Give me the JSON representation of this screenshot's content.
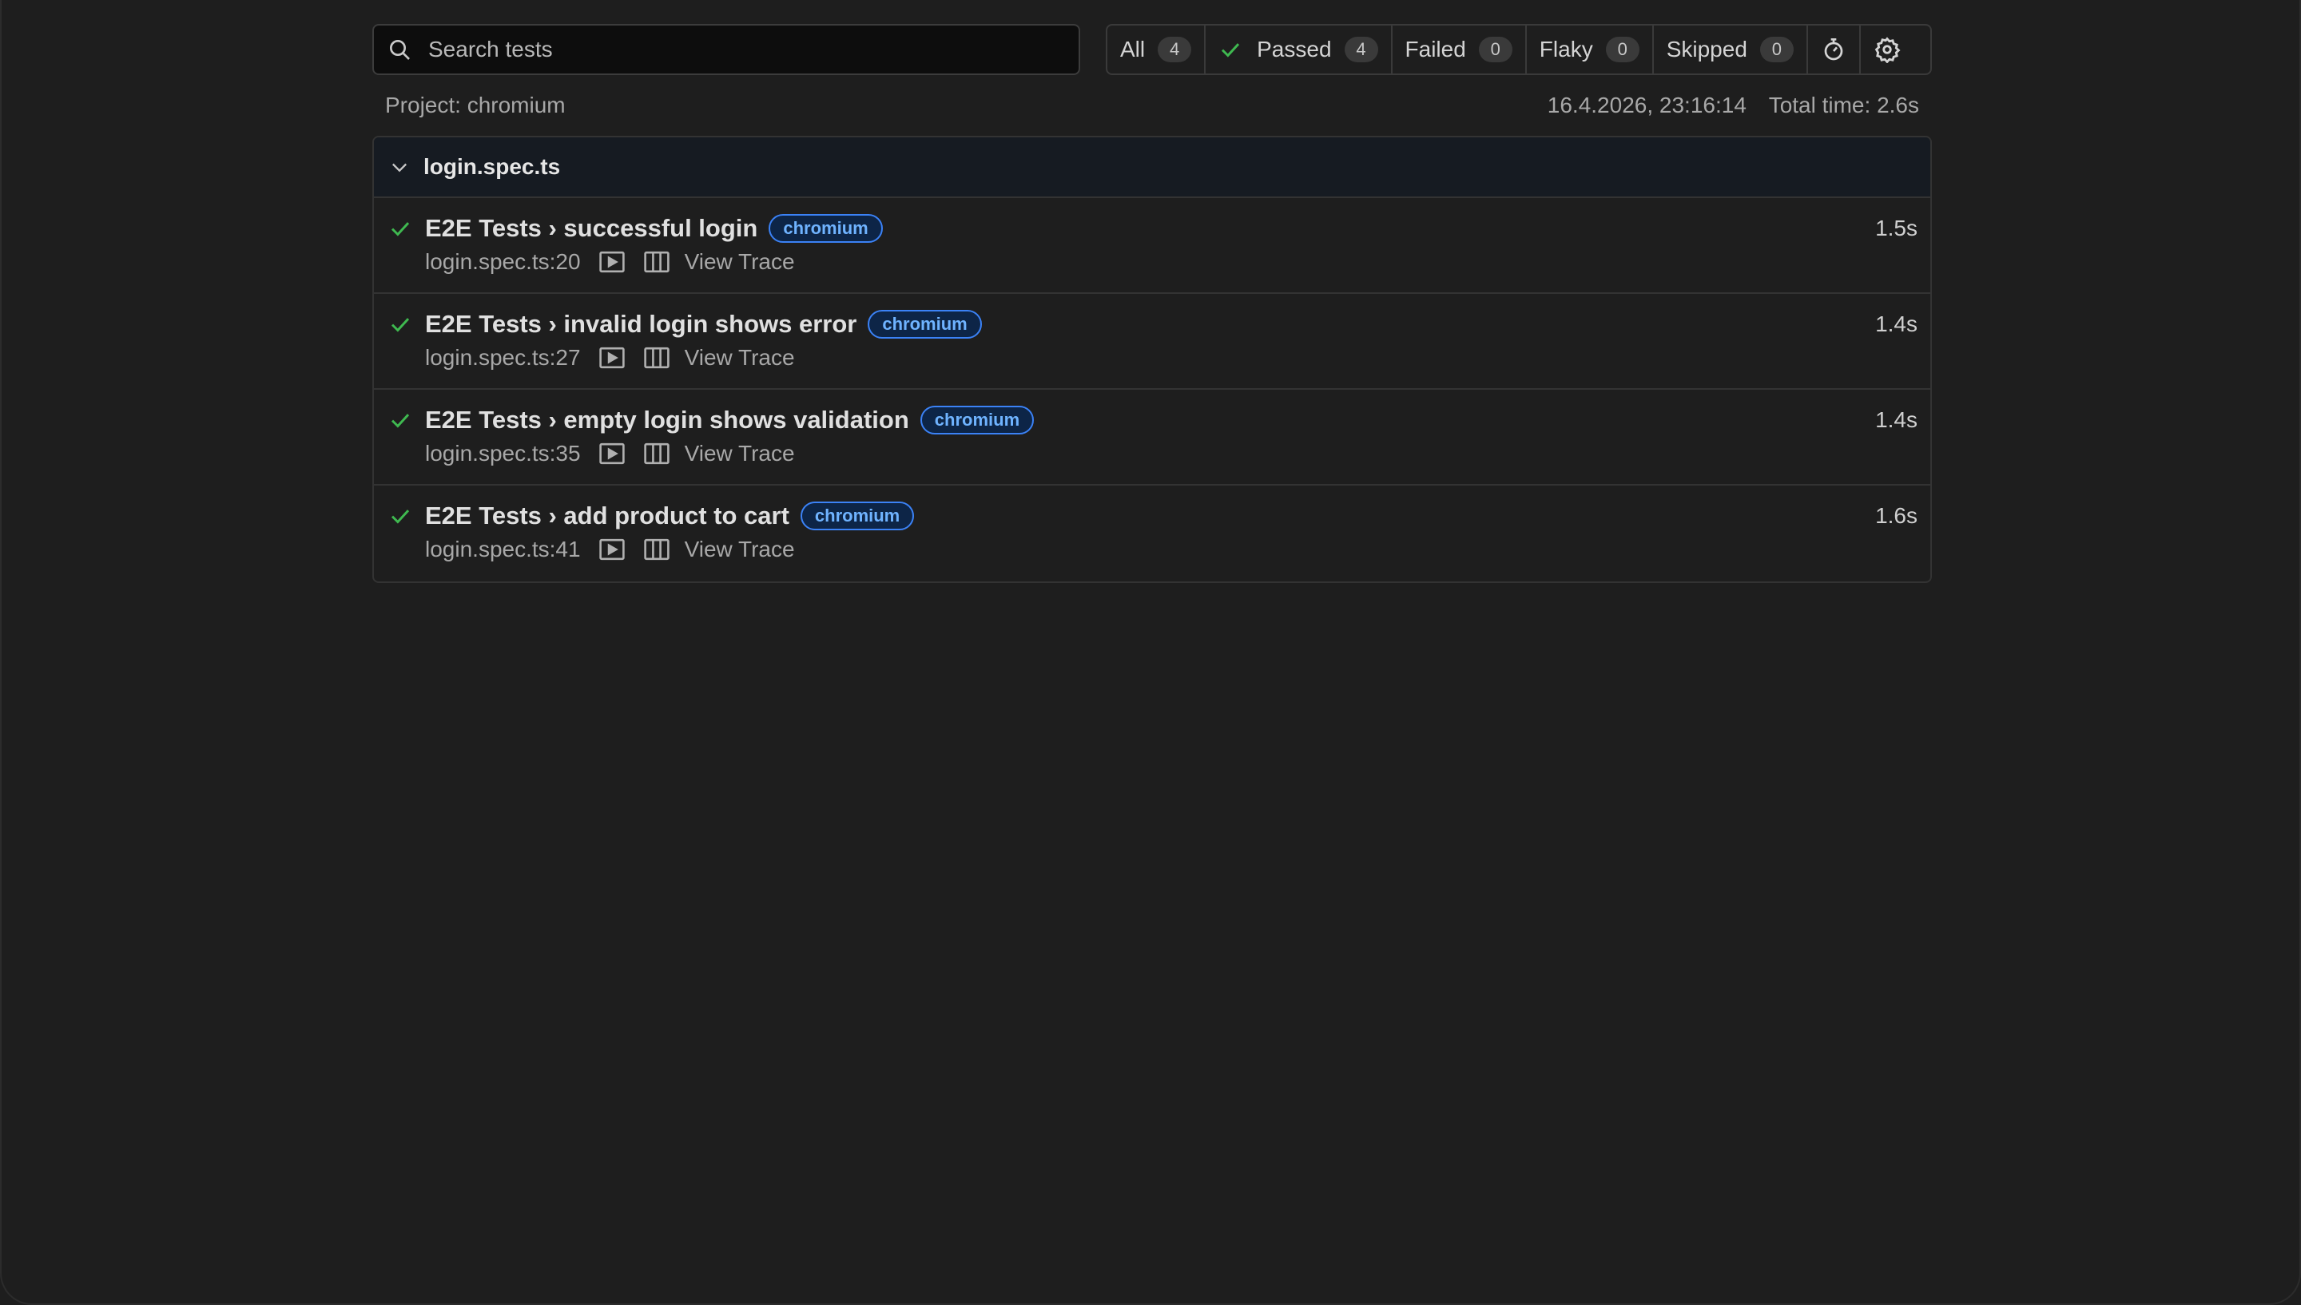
{
  "search": {
    "placeholder": "Search tests"
  },
  "filters": {
    "all": {
      "label": "All",
      "count": "4"
    },
    "passed": {
      "label": "Passed",
      "count": "4"
    },
    "failed": {
      "label": "Failed",
      "count": "0"
    },
    "flaky": {
      "label": "Flaky",
      "count": "0"
    },
    "skipped": {
      "label": "Skipped",
      "count": "0"
    }
  },
  "meta": {
    "project": "Project: chromium",
    "datetime": "16.4.2026, 23:16:14",
    "total_time": "Total time: 2.6s"
  },
  "file": {
    "name": "login.spec.ts"
  },
  "tests": [
    {
      "title": "E2E Tests › successful login",
      "tag": "chromium",
      "location": "login.spec.ts:20",
      "trace": "View Trace",
      "duration": "1.5s"
    },
    {
      "title": "E2E Tests › invalid login shows error",
      "tag": "chromium",
      "location": "login.spec.ts:27",
      "trace": "View Trace",
      "duration": "1.4s"
    },
    {
      "title": "E2E Tests › empty login shows validation",
      "tag": "chromium",
      "location": "login.spec.ts:35",
      "trace": "View Trace",
      "duration": "1.4s"
    },
    {
      "title": "E2E Tests › add product to cart",
      "tag": "chromium",
      "location": "login.spec.ts:41",
      "trace": "View Trace",
      "duration": "1.6s"
    }
  ],
  "colors": {
    "pass": "#3fb950",
    "tag_text": "#6fb3ff",
    "tag_border": "#3b82f6",
    "background": "#1e1e1e"
  },
  "icons": {
    "search": "search-icon",
    "check": "check-icon",
    "timer": "stopwatch-icon",
    "settings": "gear-icon",
    "chevron": "chevron-down-icon",
    "video": "video-icon",
    "trace": "trace-icon"
  }
}
